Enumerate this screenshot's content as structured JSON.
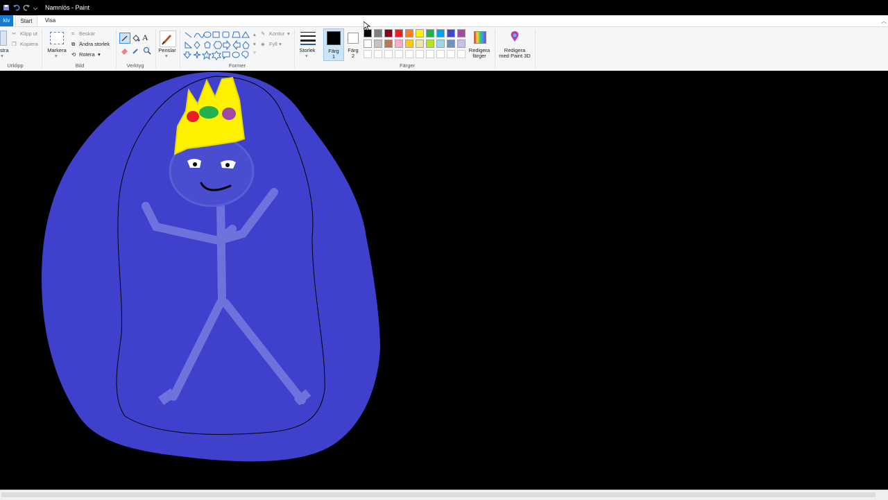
{
  "window": {
    "title": "Namnlös - Paint"
  },
  "ribbon_tabs": {
    "file": "kiv",
    "start": "Start",
    "view": "Visa"
  },
  "clipboard": {
    "paste": "stra",
    "cut": "Klipp ut",
    "copy": "Kopiera",
    "group": "Urklipp"
  },
  "image": {
    "select": "Markera",
    "crop": "Beskär",
    "resize": "Ändra storlek",
    "rotate": "Rotera",
    "group": "Bild"
  },
  "tools": {
    "group": "Verktyg",
    "text_icon": "A"
  },
  "brushes": {
    "label": "Penslar"
  },
  "shapes": {
    "outline": "Kontur",
    "fill": "Fyll",
    "group": "Former"
  },
  "size": {
    "label": "Storlek"
  },
  "color1": {
    "label_line1": "Färg",
    "label_line2": "1",
    "value": "#000000"
  },
  "color2": {
    "label_line1": "Färg",
    "label_line2": "2",
    "value": "#ffffff"
  },
  "colors": {
    "group": "Färger",
    "row1": [
      "#000000",
      "#7f7f7f",
      "#880015",
      "#ed1c24",
      "#ff7f27",
      "#fff200",
      "#22b14c",
      "#00a2e8",
      "#3f48cc",
      "#a349a4"
    ],
    "row2": [
      "#ffffff",
      "#c3c3c3",
      "#b97a57",
      "#ffaec9",
      "#ffc90e",
      "#efe4b0",
      "#b5e61d",
      "#99d9ea",
      "#7092be",
      "#c8bfe7"
    ],
    "row3": [
      "#ffffff",
      "#ffffff",
      "#ffffff",
      "#ffffff",
      "#ffffff",
      "#ffffff",
      "#ffffff",
      "#ffffff",
      "#ffffff",
      "#ffffff"
    ]
  },
  "edit_colors": {
    "line1": "Redigera",
    "line2": "färger"
  },
  "paint3d": {
    "line1": "Redigera",
    "line2": "med Paint 3D"
  },
  "drawing": {
    "blob_color": "#3f41cc",
    "crown_color": "#fff200",
    "gems": [
      "#ed1c24",
      "#22b14c",
      "#a349a4"
    ],
    "figure_color": "#6f72dd",
    "outline_color": "#000000"
  }
}
